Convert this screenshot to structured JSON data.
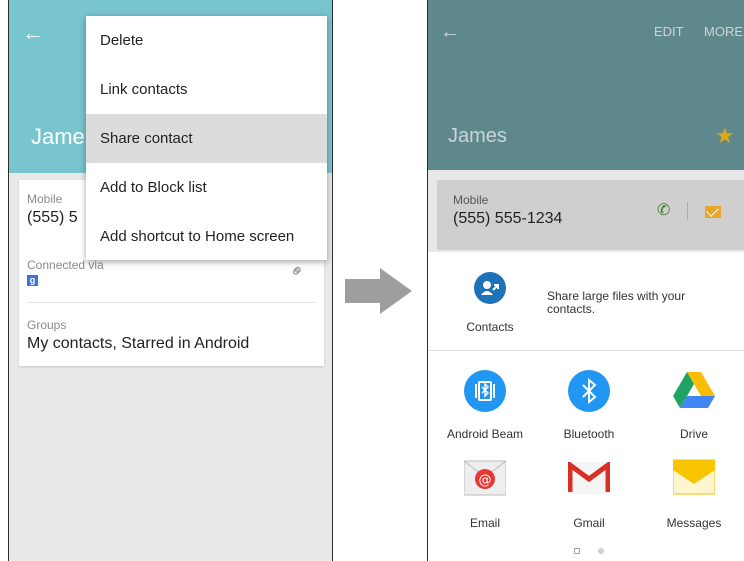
{
  "left_screen": {
    "contact_name": "James",
    "fields": {
      "mobile_label": "Mobile",
      "mobile_value": "(555) 5",
      "connected_label": "Connected via",
      "connected_icon": "google-plus-icon",
      "groups_label": "Groups",
      "groups_value": "My contacts, Starred in Android"
    },
    "menu": {
      "items": [
        "Delete",
        "Link contacts",
        "Share contact",
        "Add to Block list",
        "Add shortcut to Home screen"
      ],
      "highlighted": "Share contact"
    },
    "colors": {
      "header": "#78c4cf",
      "highlight": "#dcdcdc"
    }
  },
  "transition_icon": "right-arrow",
  "right_screen": {
    "header": {
      "actions": [
        "EDIT",
        "MORE"
      ],
      "contact_name": "James",
      "favorite": true
    },
    "card": {
      "mobile_label": "Mobile",
      "mobile_value": "(555) 555-1234"
    },
    "share_sheet": {
      "featured": {
        "app": "Contacts",
        "description": "Share large files with your contacts."
      },
      "apps": [
        {
          "label": "Android Beam",
          "icon": "android-beam-icon"
        },
        {
          "label": "Bluetooth",
          "icon": "bluetooth-icon"
        },
        {
          "label": "Drive",
          "icon": "drive-icon"
        },
        {
          "label": "Email",
          "icon": "email-icon"
        },
        {
          "label": "Gmail",
          "icon": "gmail-icon"
        },
        {
          "label": "Messages",
          "icon": "messages-icon"
        }
      ],
      "page_count": 2,
      "current_page": 1
    },
    "colors": {
      "header": "#5f888d",
      "star": "#e0a51a",
      "call": "#3d7d2a",
      "message": "#e8a529"
    }
  }
}
